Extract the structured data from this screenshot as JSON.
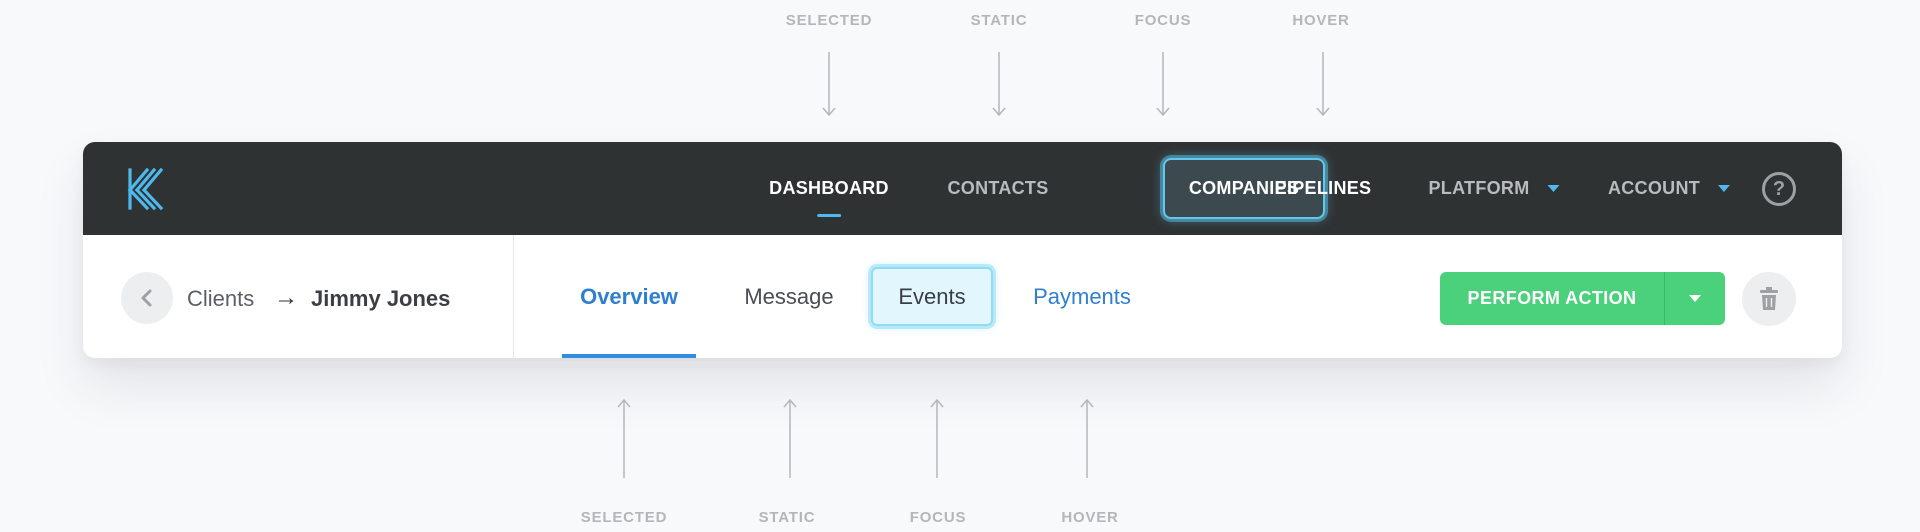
{
  "annotations": {
    "top": [
      "SELECTED",
      "STATIC",
      "FOCUS",
      "HOVER"
    ],
    "bottom": [
      "SELECTED",
      "STATIC",
      "FOCUS",
      "HOVER"
    ]
  },
  "topnav": {
    "logo_icon": "k-logo-icon",
    "items": [
      {
        "label": "DASHBOARD",
        "state": "selected"
      },
      {
        "label": "CONTACTS",
        "state": "static"
      },
      {
        "label": "COMPANIES",
        "state": "focus"
      },
      {
        "label": "PIPELINES",
        "state": "hover"
      },
      {
        "label": "PLATFORM",
        "state": "static",
        "dropdown": true
      },
      {
        "label": "ACCOUNT",
        "state": "static",
        "dropdown": true
      }
    ],
    "help_label": "?"
  },
  "breadcrumb": {
    "back_icon": "chevron-left-icon",
    "parent": "Clients",
    "separator": "→",
    "current": "Jimmy Jones"
  },
  "tabs": [
    {
      "label": "Overview",
      "state": "selected"
    },
    {
      "label": "Message",
      "state": "static"
    },
    {
      "label": "Events",
      "state": "focus"
    },
    {
      "label": "Payments",
      "state": "hover"
    }
  ],
  "actions": {
    "primary_label": "PERFORM ACTION",
    "dropdown_icon": "caret-down-icon",
    "delete_icon": "trash-icon"
  },
  "colors": {
    "topbar_bg": "#2f3233",
    "accent_blue": "#4fb8ec",
    "tab_blue": "#2f7fd0",
    "action_green": "#4bd07c",
    "page_bg": "#f8f9fb"
  }
}
